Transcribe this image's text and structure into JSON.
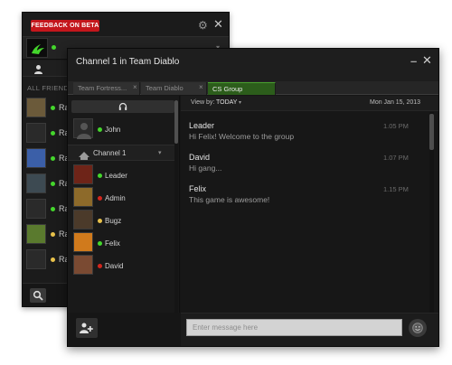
{
  "back_window": {
    "feedback_label": "FEEDBACK ON BETA",
    "all_friends_label": "ALL FRIENDS",
    "friends": [
      {
        "name": "Ra",
        "status_color": "#44d62c",
        "avatar_color": "#6b5a3a"
      },
      {
        "name": "Ra",
        "status_color": "#44d62c",
        "avatar_color": "#2a2a2a"
      },
      {
        "name": "Ra",
        "status_color": "#44d62c",
        "avatar_color": "#3b5fa8"
      },
      {
        "name": "Ra",
        "status_color": "#44d62c",
        "avatar_color": "#3d4a52"
      },
      {
        "name": "Ra",
        "status_color": "#44d62c",
        "avatar_color": "#2a2a2a"
      },
      {
        "name": "Ra",
        "status_color": "#e8c14a",
        "avatar_color": "#5a7a2e"
      },
      {
        "name": "Ra",
        "status_color": "#e8c14a",
        "avatar_color": "#2a2a2a"
      }
    ]
  },
  "front_window": {
    "title": "Channel 1 in Team Diablo",
    "tabs": [
      {
        "label": "Team Fortress...",
        "active": false
      },
      {
        "label": "Team Diablo",
        "active": false
      },
      {
        "label": "CS Group",
        "active": true
      }
    ],
    "tab_close_glyph": "×",
    "channel_label": "Channel 1",
    "top_user": {
      "name": "John",
      "status_color": "#44d62c"
    },
    "users": [
      {
        "name": "Leader",
        "status_color": "#44d62c",
        "avatar_color": "#6e2418"
      },
      {
        "name": "Admin",
        "status_color": "#d2261d",
        "avatar_color": "#8d6a2a"
      },
      {
        "name": "Bugz",
        "status_color": "#e8c14a",
        "avatar_color": "#4b3a2a"
      },
      {
        "name": "Felix",
        "status_color": "#44d62c",
        "avatar_color": "#d07a1c"
      },
      {
        "name": "David",
        "status_color": "#d2261d",
        "avatar_color": "#7a4a32"
      }
    ],
    "view_by_label": "View by:",
    "view_by_value": "TODAY",
    "date": "Mon Jan 15, 2013",
    "messages": [
      {
        "sender": "Leader",
        "text": "Hi Felix! Welcome to the group",
        "time": "1.05 PM"
      },
      {
        "sender": "David",
        "text": "Hi gang...",
        "time": "1.07 PM"
      },
      {
        "sender": "Felix",
        "text": "This game is awesome!",
        "time": "1.15 PM"
      }
    ],
    "input_placeholder": "Enter message here"
  },
  "colors": {
    "accent_green": "#44d62c",
    "feedback_red": "#c4161c",
    "active_tab": "#2c5d1b"
  }
}
